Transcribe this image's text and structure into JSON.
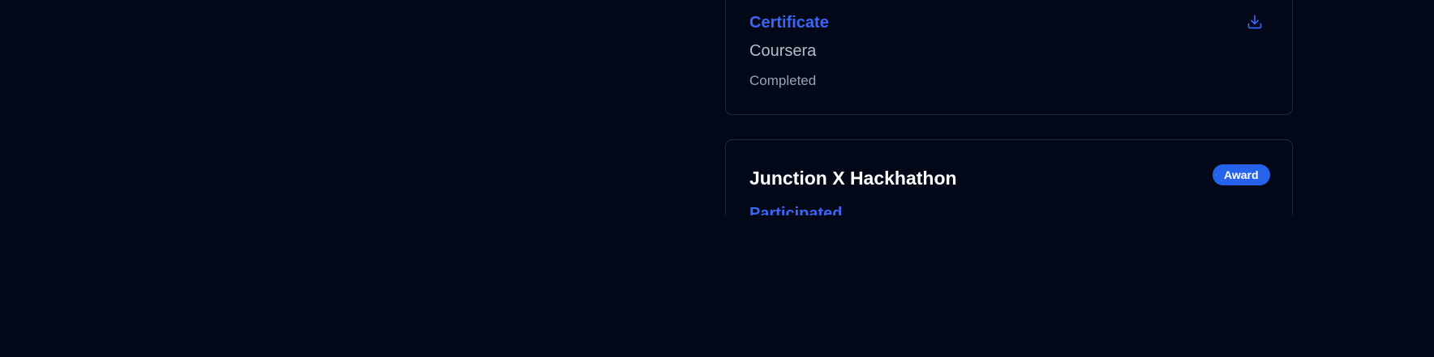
{
  "certificate_card": {
    "type_label": "Certificate",
    "issuer": "Coursera",
    "status": "Completed",
    "download_icon": "download-icon"
  },
  "hackathon_card": {
    "title": "Junction X Hackhathon",
    "badge": "Award",
    "subtitle": "Participated"
  },
  "colors": {
    "background": "#020817",
    "accent": "#3b66f5",
    "badge": "#2563eb",
    "border": "#1e293b"
  }
}
